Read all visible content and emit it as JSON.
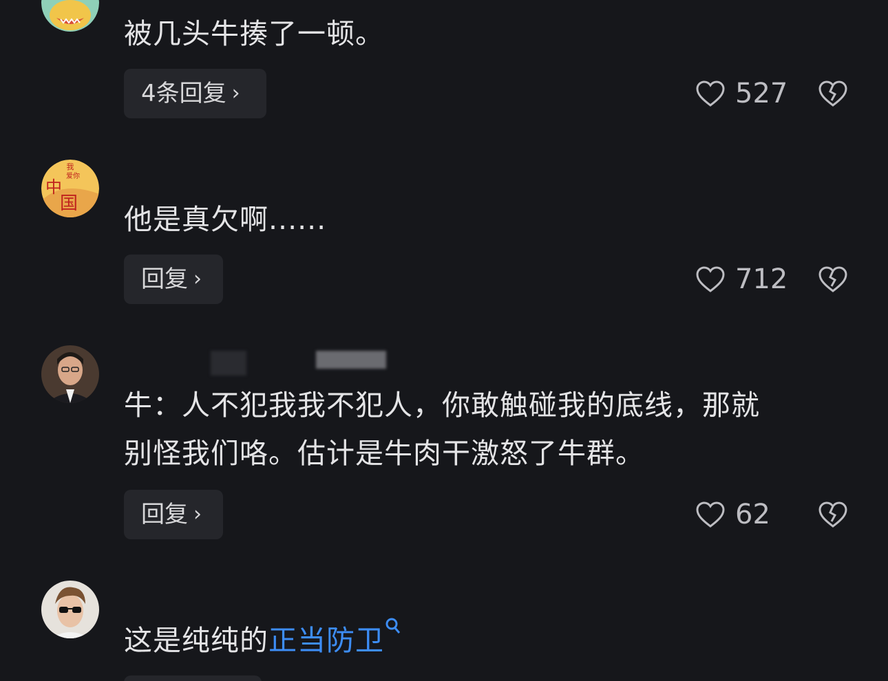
{
  "comments": [
    {
      "text": "被几头牛揍了一顿。",
      "reply_label": "4条回复",
      "like_count": "527",
      "avatar_icon": "cartoon-creature-icon"
    },
    {
      "text": "他是真欠啊......",
      "reply_label": "回复",
      "like_count": "712",
      "avatar_icon": "china-flag-avatar-icon",
      "avatar_text": {
        "top": "我",
        "middle": "爱你",
        "left": "中",
        "bottom": "国"
      }
    },
    {
      "text_line1": "牛：人不犯我我不犯人，你敢触碰我的底线，那就",
      "text_line2": "别怪我们咯。估计是牛肉干激怒了牛群。",
      "reply_label": "回复",
      "like_count": "62",
      "avatar_icon": "man-portrait-icon"
    },
    {
      "text_prefix": "这是纯纯的",
      "text_link": "正当防卫",
      "avatar_icon": "man-sunglasses-icon"
    }
  ],
  "chevron": "›",
  "colors": {
    "background": "#16171b",
    "text": "#e4e4e6",
    "link": "#3d8df5",
    "button_bg": "#25262b"
  }
}
